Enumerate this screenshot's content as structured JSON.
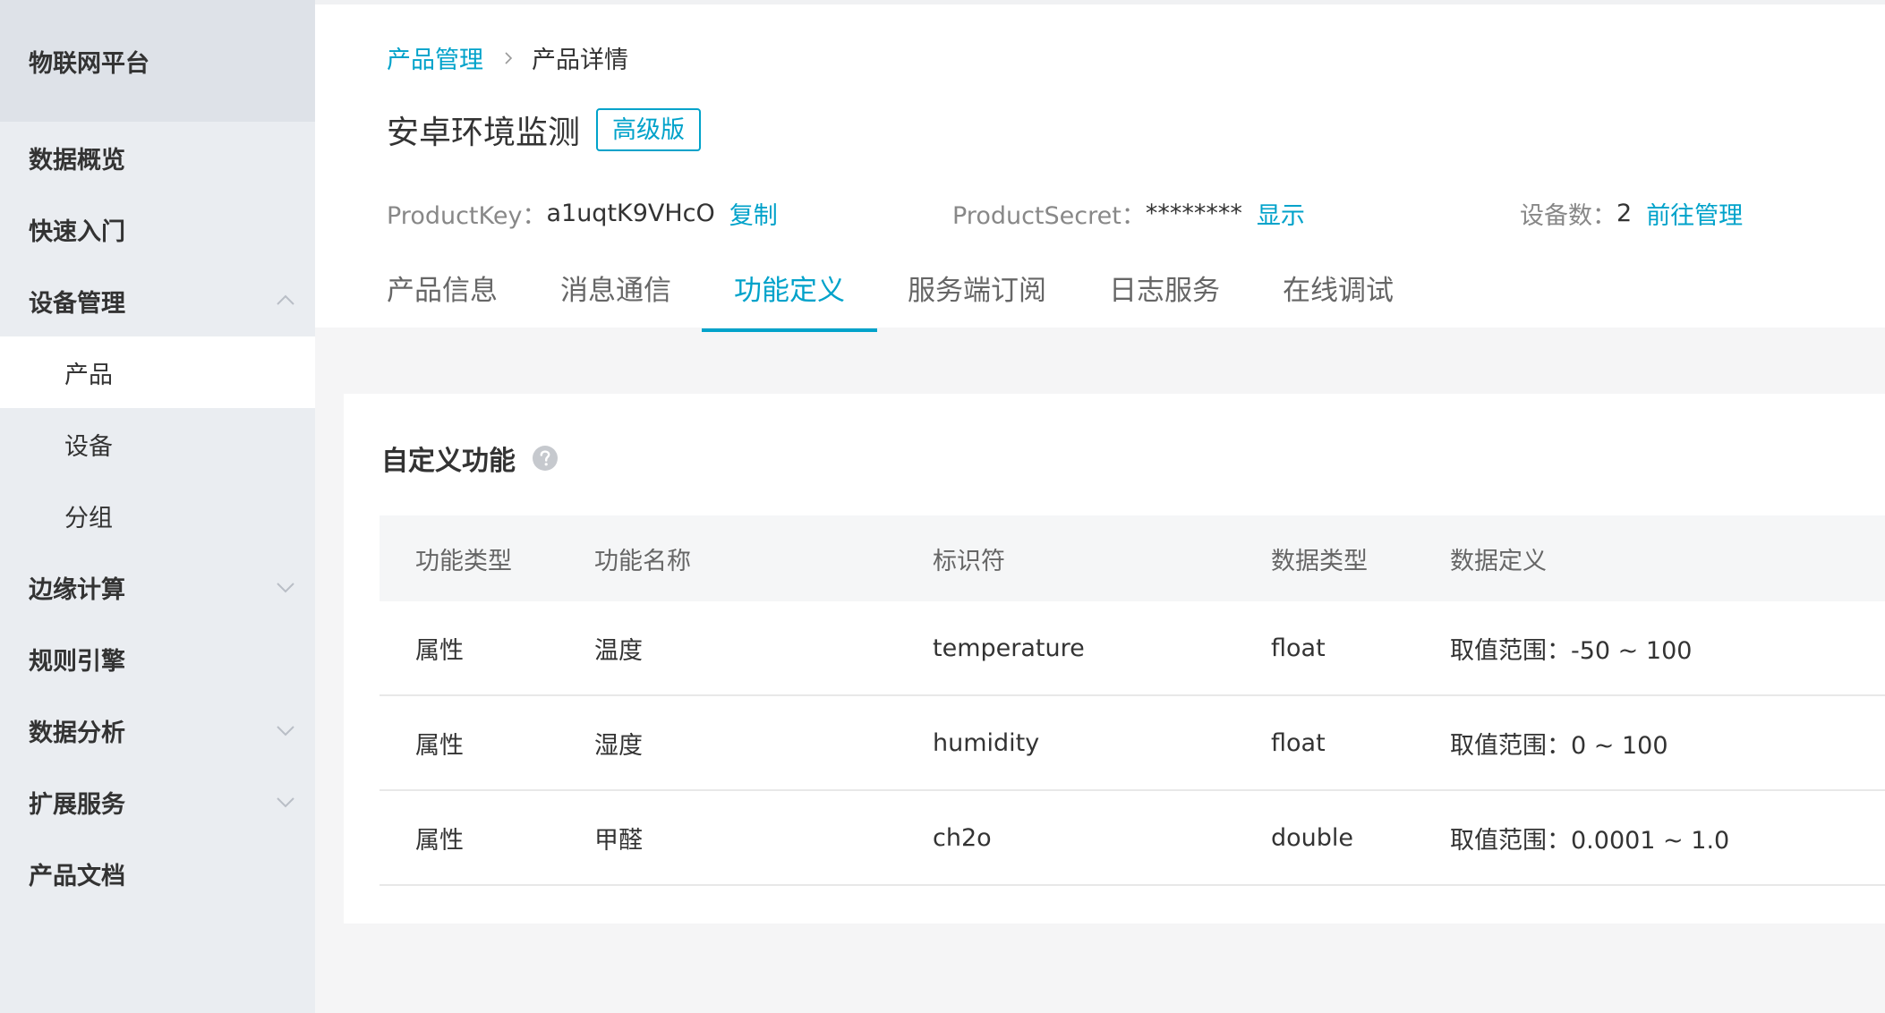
{
  "app": {
    "title": "物联网平台"
  },
  "sidebar": {
    "items": [
      {
        "label": "数据概览"
      },
      {
        "label": "快速入门"
      },
      {
        "label": "设备管理"
      },
      {
        "label": "产品"
      },
      {
        "label": "设备"
      },
      {
        "label": "分组"
      },
      {
        "label": "边缘计算"
      },
      {
        "label": "规则引擎"
      },
      {
        "label": "数据分析"
      },
      {
        "label": "扩展服务"
      },
      {
        "label": "产品文档"
      }
    ],
    "active_item": "产品"
  },
  "breadcrumb": {
    "parent": "产品管理",
    "current": "产品详情"
  },
  "product": {
    "name": "安卓环境监测",
    "edition": "高级版",
    "key_label": "ProductKey：",
    "key_value": "a1uqtK9VHcO",
    "copy_label": "复制",
    "secret_label": "ProductSecret：",
    "secret_value": "********",
    "show_label": "显示",
    "device_count_label": "设备数：",
    "device_count_value": "2",
    "manage_label": "前往管理"
  },
  "tabs": [
    {
      "label": "产品信息"
    },
    {
      "label": "消息通信"
    },
    {
      "label": "功能定义"
    },
    {
      "label": "服务端订阅"
    },
    {
      "label": "日志服务"
    },
    {
      "label": "在线调试"
    }
  ],
  "active_tab": "功能定义",
  "custom_functions": {
    "title": "自定义功能",
    "columns": [
      "功能类型",
      "功能名称",
      "标识符",
      "数据类型",
      "数据定义"
    ],
    "rows": [
      [
        "属性",
        "温度",
        "temperature",
        "float",
        "取值范围：-50 ~ 100"
      ],
      [
        "属性",
        "湿度",
        "humidity",
        "float",
        "取值范围：0 ~ 100"
      ],
      [
        "属性",
        "甲醛",
        "ch2o",
        "double",
        "取值范围：0.0001 ~ 1.0"
      ]
    ]
  },
  "colors": {
    "accent": "#00a2ca",
    "sidebar_bg": "#eaedf1",
    "brand_bg": "#dee2e8",
    "page_bg": "#f5f5f6"
  },
  "icons": {
    "breadcrumb_separator": "chevron-right-icon",
    "expanded": "chevron-up-icon",
    "collapsed": "chevron-down-icon",
    "help": "question-circle-icon"
  }
}
